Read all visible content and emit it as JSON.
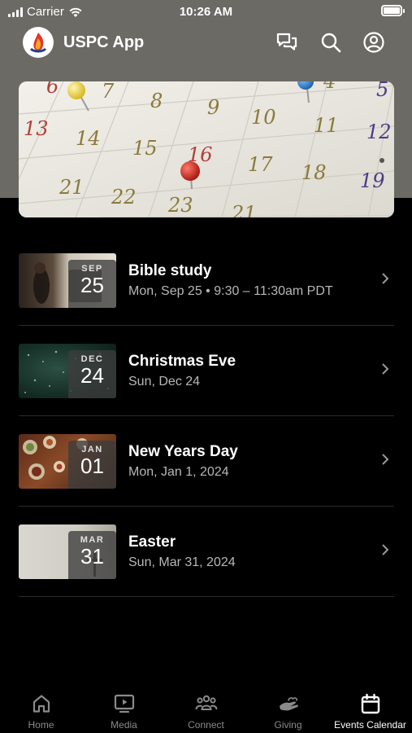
{
  "status_bar": {
    "carrier": "Carrier",
    "time": "10:26 AM"
  },
  "header": {
    "title": "USPC App",
    "icons": [
      "chat-icon",
      "search-icon",
      "account-icon"
    ]
  },
  "hero": {
    "day_labels": [
      "6",
      "7",
      "8",
      "9",
      "10",
      "11",
      "4",
      "5",
      "13",
      "14",
      "15",
      "16",
      "17",
      "18",
      "12",
      "19",
      "21",
      "22",
      "23",
      "21"
    ]
  },
  "events": [
    {
      "month": "SEP",
      "day": "25",
      "title": "Bible study",
      "subtitle": "Mon, Sep 25 • 9:30 – 11:30am PDT"
    },
    {
      "month": "DEC",
      "day": "24",
      "title": "Christmas Eve",
      "subtitle": "Sun, Dec 24"
    },
    {
      "month": "JAN",
      "day": "01",
      "title": "New Years Day",
      "subtitle": "Mon, Jan 1, 2024"
    },
    {
      "month": "MAR",
      "day": "31",
      "title": "Easter",
      "subtitle": "Sun, Mar 31, 2024"
    }
  ],
  "tabs": [
    {
      "label": "Home",
      "icon": "home-icon"
    },
    {
      "label": "Media",
      "icon": "tv-play-icon"
    },
    {
      "label": "Connect",
      "icon": "people-group-icon"
    },
    {
      "label": "Giving",
      "icon": "giving-hand-icon"
    },
    {
      "label": "Events Calendar",
      "icon": "calendar-icon",
      "active": true
    }
  ],
  "colors": {
    "header_bg": "#6c6a64",
    "background": "#000000",
    "muted_text": "#b7b7b7",
    "inactive_tab": "#8a8a8a"
  }
}
